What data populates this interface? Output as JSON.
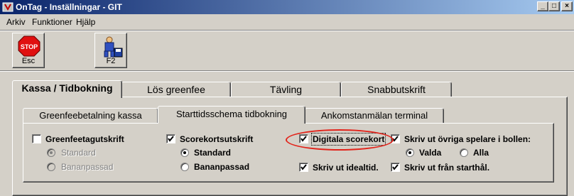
{
  "window": {
    "title": "OnTag - Inställningar - GIT",
    "buttons": {
      "minimize": "_",
      "maximize": "□",
      "close": "×"
    }
  },
  "menu": {
    "items": [
      "Arkiv",
      "Funktioner",
      "Hjälp"
    ]
  },
  "toolbar": {
    "esc_label": "Esc",
    "esc_icon_text": "STOP",
    "f2_label": "F2"
  },
  "tabs": {
    "outer": [
      "Kassa / Tidbokning",
      "Lös greenfee",
      "Tävling",
      "Snabbutskrift"
    ],
    "outer_active": 0,
    "inner": [
      "Greenfeebetalning kassa",
      "Starttidsschema tidbokning",
      "Ankomstanmälan terminal"
    ],
    "inner_active": 1
  },
  "options": {
    "greenfee_print": {
      "label": "Greenfeetagutskrift",
      "checked": false
    },
    "greenfee_standard": {
      "label": "Standard",
      "selected": true,
      "disabled": true
    },
    "greenfee_banan": {
      "label": "Bananpassad",
      "selected": false,
      "disabled": true
    },
    "score_print": {
      "label": "Scorekortsutskrift",
      "checked": true
    },
    "score_standard": {
      "label": "Standard",
      "selected": true
    },
    "score_banan": {
      "label": "Bananpassad",
      "selected": false
    },
    "digital": {
      "label": "Digitala scorekort",
      "checked": true
    },
    "ideal": {
      "label": "Skriv ut idealtid.",
      "checked": true
    },
    "other_players": {
      "label": "Skriv ut övriga spelare i bollen:",
      "checked": true
    },
    "valda": {
      "label": "Valda",
      "selected": true
    },
    "alla": {
      "label": "Alla",
      "selected": false
    },
    "from_hole": {
      "label": "Skriv ut från starthål.",
      "checked": true
    }
  },
  "annotation_color": "#e2231a"
}
